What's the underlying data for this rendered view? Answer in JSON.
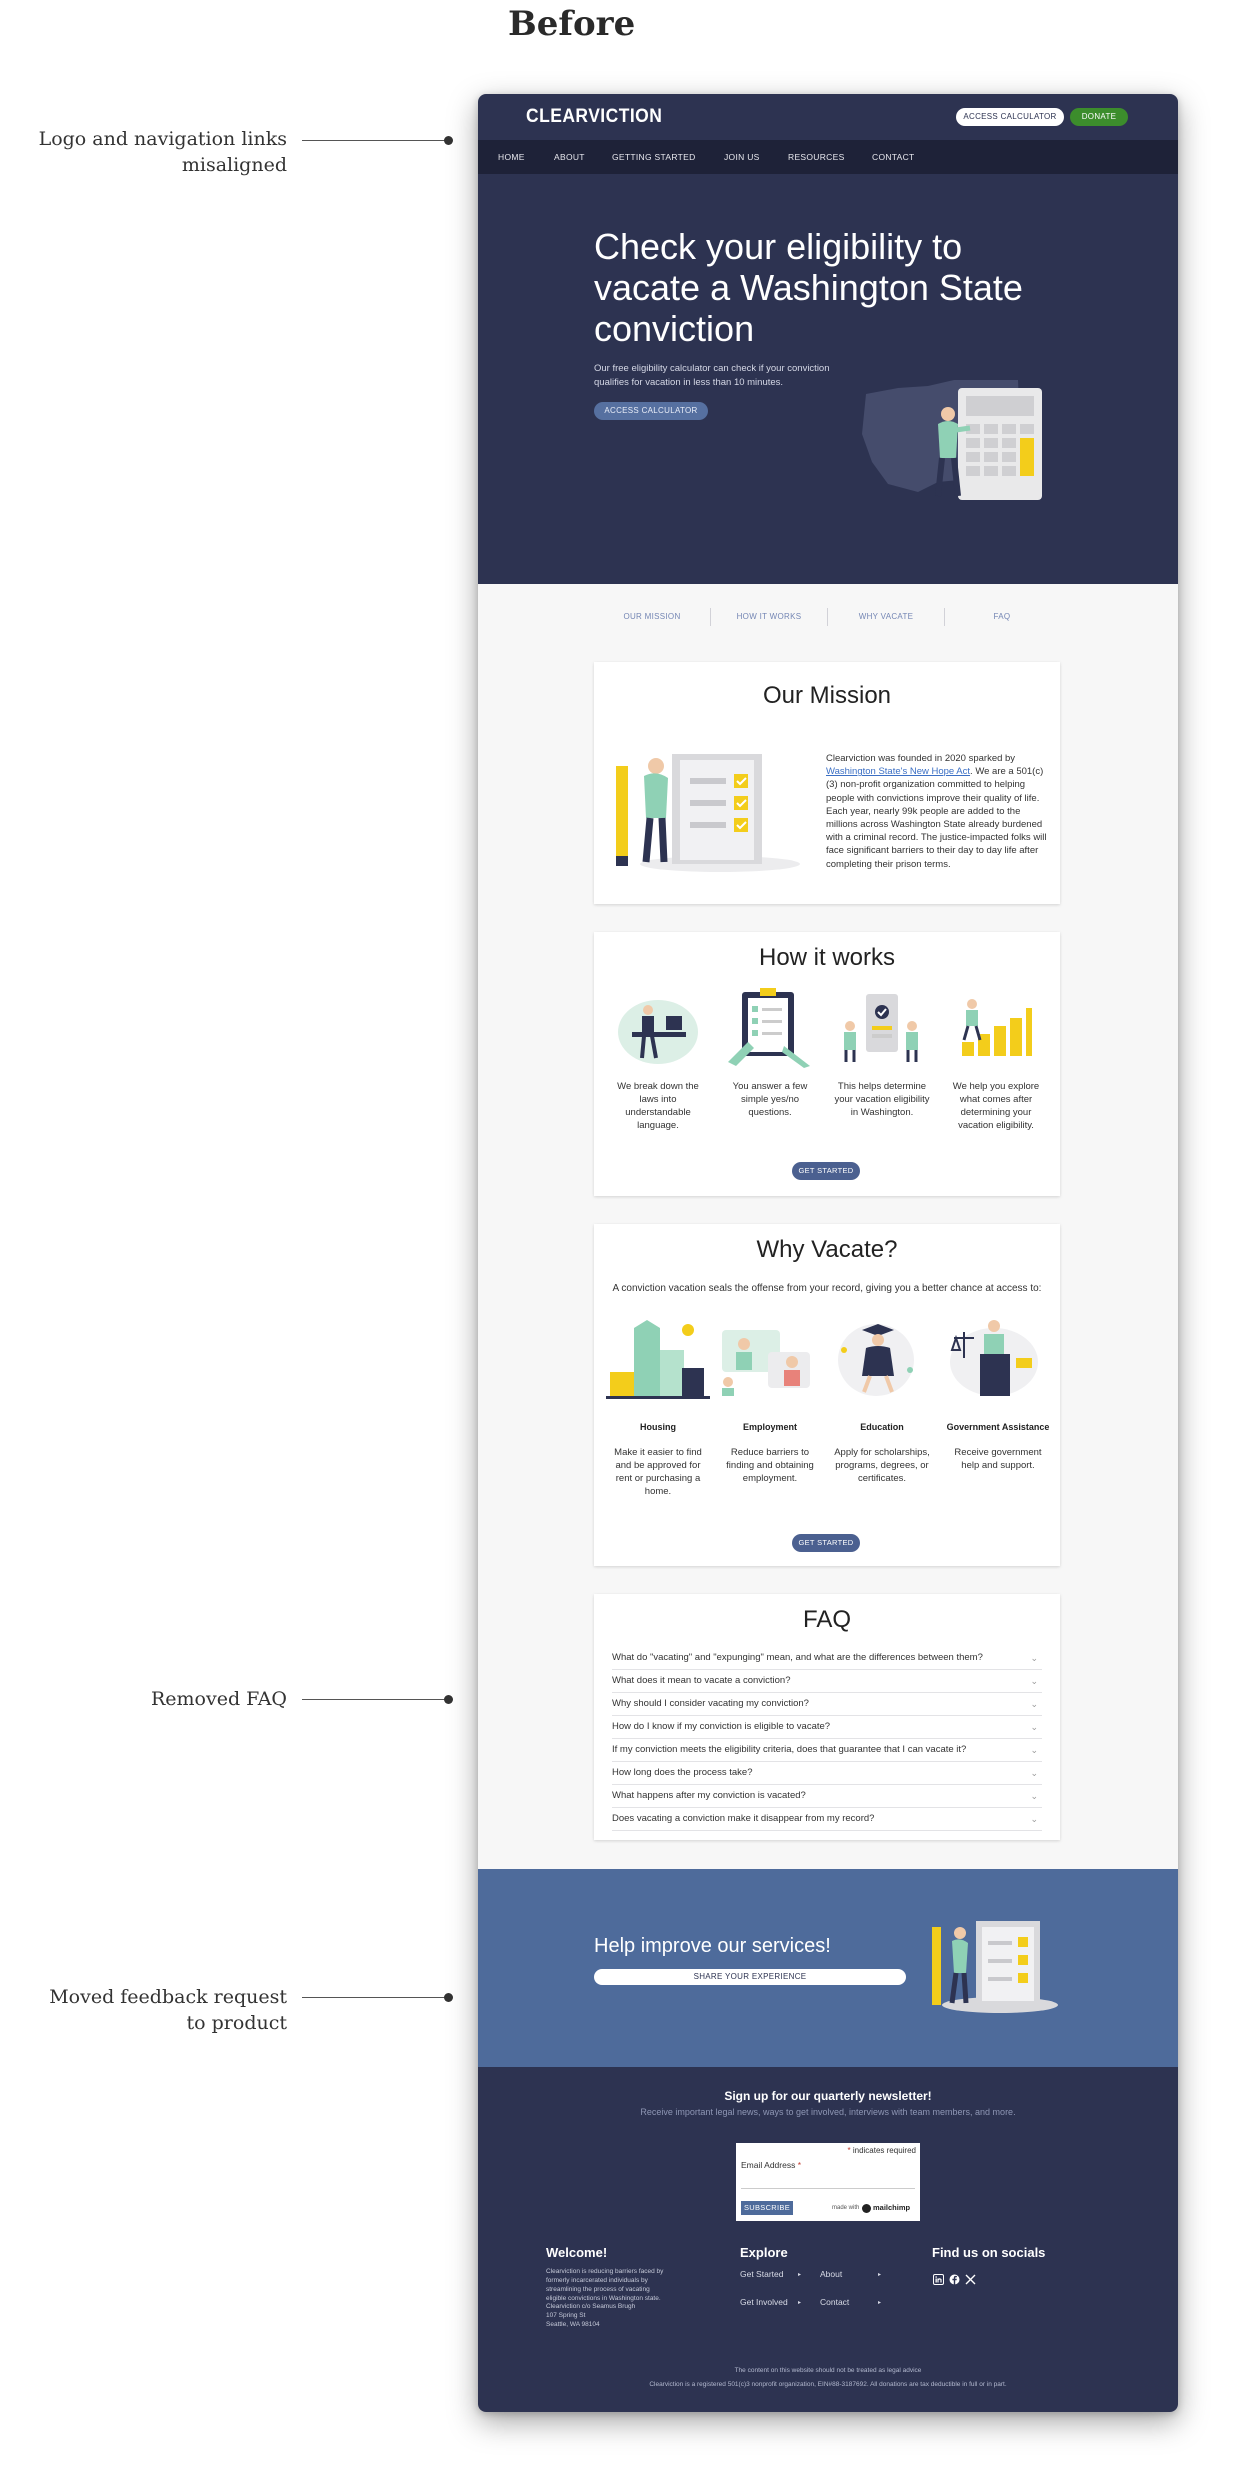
{
  "page_heading": "Before",
  "annotations": [
    {
      "lines": [
        "Logo and navigation links",
        "misaligned"
      ]
    },
    {
      "lines": [
        "Removed FAQ"
      ]
    },
    {
      "lines": [
        "Moved feedback request",
        "to product"
      ]
    }
  ],
  "site": {
    "logo": "CLEARVICTION",
    "top_buttons": {
      "calculator": "ACCESS CALCULATOR",
      "donate": "DONATE"
    },
    "nav": [
      "HOME",
      "ABOUT",
      "GETTING STARTED",
      "JOIN US",
      "RESOURCES",
      "CONTACT"
    ],
    "hero": {
      "title": "Check your eligibility to vacate a Washington State conviction",
      "subtitle": "Our free eligibility calculator can check if your conviction qualifies for vacation in less than 10 minutes.",
      "button": "ACCESS CALCULATOR"
    },
    "tabs": [
      "OUR MISSION",
      "HOW IT WORKS",
      "WHY VACATE",
      "FAQ"
    ],
    "mission": {
      "title": "Our Mission",
      "text_before_link": "Clearviction was founded in 2020 sparked by ",
      "link": "Washington State's New Hope Act",
      "text_after_link": ". We are a 501(c)(3) non-profit organization committed to helping people with convictions improve their quality of life.",
      "paragraph2": "Each year, nearly 99k people are added to the millions across Washington State already burdened with a criminal record. The justice-impacted folks will face significant barriers to their day to day life after completing their prison terms."
    },
    "how_it_works": {
      "title": "How it works",
      "steps": [
        "We break down the laws into understandable language.",
        "You answer a few simple yes/no questions.",
        "This helps determine your vacation eligibility in Washington.",
        "We help you explore what comes after determining your vacation eligibility."
      ],
      "button": "GET STARTED"
    },
    "why_vacate": {
      "title": "Why Vacate?",
      "intro": "A conviction vacation seals the offense from your record, giving you a better chance at access to:",
      "benefits": [
        {
          "title": "Housing",
          "desc": "Make it easier to find and be approved for rent or purchasing a home."
        },
        {
          "title": "Employment",
          "desc": "Reduce barriers to finding and obtaining employment."
        },
        {
          "title": "Education",
          "desc": "Apply for scholarships, programs, degrees, or certificates."
        },
        {
          "title": "Government Assistance",
          "desc": "Receive government help and support."
        }
      ],
      "button": "GET STARTED"
    },
    "faq": {
      "title": "FAQ",
      "questions": [
        "What do \"vacating\" and \"expunging\" mean, and what are the differences between them?",
        "What does it mean to vacate a conviction?",
        "Why should I consider vacating my conviction?",
        "How do I know if my conviction is eligible to vacate?",
        "If my conviction meets the eligibility criteria, does that guarantee that I can vacate it?",
        "How long does the process take?",
        "What happens after my conviction is vacated?",
        "Does vacating a conviction make it disappear from my record?"
      ]
    },
    "feedback": {
      "title": "Help improve our services!",
      "button": "SHARE YOUR EXPERIENCE"
    },
    "newsletter": {
      "title": "Sign up for our quarterly newsletter!",
      "subtitle": "Receive important legal news, ways to get involved, interviews with team members, and more.",
      "required_note": "indicates required",
      "email_label": "Email Address",
      "subscribe": "SUBSCRIBE",
      "made_with": "made with",
      "brand": "mailchimp"
    },
    "footer": {
      "welcome": {
        "title": "Welcome!",
        "text": "Clearviction is reducing barriers faced by formerly incarcerated individuals by streamlining the process of vacating eligible convictions in Washington state.",
        "address": [
          "Clearviction c/o Seamus Brugh",
          "107 Spring St",
          "Seattle, WA 98104"
        ]
      },
      "explore": {
        "title": "Explore",
        "links": [
          "Get Started",
          "About",
          "Get Involved",
          "Contact"
        ]
      },
      "socials": {
        "title": "Find us on socials",
        "icons": [
          "linkedin-icon",
          "facebook-icon",
          "x-icon"
        ]
      },
      "legal1": "The content on this website should not be treated as legal advice",
      "legal2": "Clearviction is a registered 501(c)3 nonprofit organization, EIN#88-3187692. All donations are tax deductible in full or in part."
    }
  },
  "colors": {
    "navy": "#2d3351",
    "dark_nav": "#1e2238",
    "blue": "#4e6b9b",
    "green": "#3c8d2c",
    "mint": "#8fd1b5",
    "yellow": "#f3cd1b"
  }
}
